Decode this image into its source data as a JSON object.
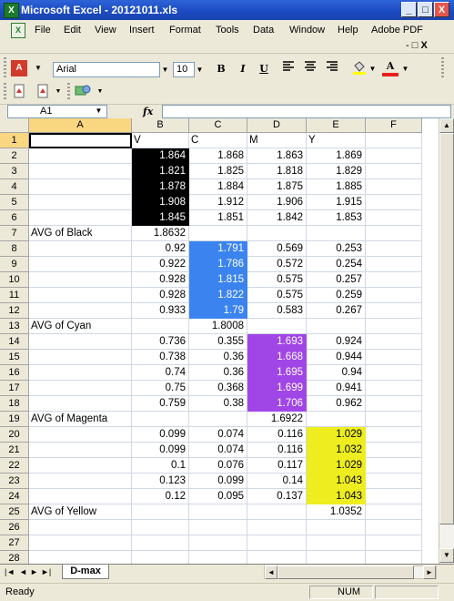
{
  "window": {
    "title": "Microsoft Excel - 20121011.xls",
    "app_icon": "X",
    "controls": [
      "_",
      "□",
      "X"
    ]
  },
  "menu": {
    "items": [
      "File",
      "Edit",
      "View",
      "Insert",
      "Format",
      "Tools",
      "Data",
      "Window",
      "Help",
      "Adobe PDF"
    ],
    "doc_controls": [
      "-",
      "□",
      "X"
    ]
  },
  "toolbar": {
    "font_name": "Arial",
    "font_size": "10",
    "bold": "B",
    "italic": "I",
    "underline": "U",
    "font_color_glyph": "A"
  },
  "formula_bar": {
    "name_box": "A1",
    "fx_label": "fx",
    "formula": ""
  },
  "sheet": {
    "columns": [
      "A",
      "B",
      "C",
      "D",
      "E",
      "F"
    ],
    "colors": {
      "black": "#000000",
      "cyan": "#3b84f0",
      "magenta": "#a046e6",
      "yellow": "#eded20",
      "header_sel": "#f9d680"
    },
    "rows": [
      {
        "r": "1",
        "A": "",
        "B": "V",
        "C": "C",
        "D": "M",
        "E": "Y",
        "F": ""
      },
      {
        "r": "2",
        "A": "",
        "B": "1.864",
        "C": "1.868",
        "D": "1.863",
        "E": "1.869",
        "F": ""
      },
      {
        "r": "3",
        "A": "",
        "B": "1.821",
        "C": "1.825",
        "D": "1.818",
        "E": "1.829",
        "F": ""
      },
      {
        "r": "4",
        "A": "",
        "B": "1.878",
        "C": "1.884",
        "D": "1.875",
        "E": "1.885",
        "F": ""
      },
      {
        "r": "5",
        "A": "",
        "B": "1.908",
        "C": "1.912",
        "D": "1.906",
        "E": "1.915",
        "F": ""
      },
      {
        "r": "6",
        "A": "",
        "B": "1.845",
        "C": "1.851",
        "D": "1.842",
        "E": "1.853",
        "F": ""
      },
      {
        "r": "7",
        "A": "AVG of Black",
        "B": "1.8632",
        "C": "",
        "D": "",
        "E": "",
        "F": ""
      },
      {
        "r": "8",
        "A": "",
        "B": "0.92",
        "C": "1.791",
        "D": "0.569",
        "E": "0.253",
        "F": ""
      },
      {
        "r": "9",
        "A": "",
        "B": "0.922",
        "C": "1.786",
        "D": "0.572",
        "E": "0.254",
        "F": ""
      },
      {
        "r": "10",
        "A": "",
        "B": "0.928",
        "C": "1.815",
        "D": "0.575",
        "E": "0.257",
        "F": ""
      },
      {
        "r": "11",
        "A": "",
        "B": "0.928",
        "C": "1.822",
        "D": "0.575",
        "E": "0.259",
        "F": ""
      },
      {
        "r": "12",
        "A": "",
        "B": "0.933",
        "C": "1.79",
        "D": "0.583",
        "E": "0.267",
        "F": ""
      },
      {
        "r": "13",
        "A": "AVG of Cyan",
        "B": "",
        "C": "1.8008",
        "D": "",
        "E": "",
        "F": ""
      },
      {
        "r": "14",
        "A": "",
        "B": "0.736",
        "C": "0.355",
        "D": "1.693",
        "E": "0.924",
        "F": ""
      },
      {
        "r": "15",
        "A": "",
        "B": "0.738",
        "C": "0.36",
        "D": "1.668",
        "E": "0.944",
        "F": ""
      },
      {
        "r": "16",
        "A": "",
        "B": "0.74",
        "C": "0.36",
        "D": "1.695",
        "E": "0.94",
        "F": ""
      },
      {
        "r": "17",
        "A": "",
        "B": "0.75",
        "C": "0.368",
        "D": "1.699",
        "E": "0.941",
        "F": ""
      },
      {
        "r": "18",
        "A": "",
        "B": "0.759",
        "C": "0.38",
        "D": "1.706",
        "E": "0.962",
        "F": ""
      },
      {
        "r": "19",
        "A": "AVG of Magenta",
        "B": "",
        "C": "",
        "D": "1.6922",
        "E": "",
        "F": ""
      },
      {
        "r": "20",
        "A": "",
        "B": "0.099",
        "C": "0.074",
        "D": "0.116",
        "E": "1.029",
        "F": ""
      },
      {
        "r": "21",
        "A": "",
        "B": "0.099",
        "C": "0.074",
        "D": "0.116",
        "E": "1.032",
        "F": ""
      },
      {
        "r": "22",
        "A": "",
        "B": "0.1",
        "C": "0.076",
        "D": "0.117",
        "E": "1.029",
        "F": ""
      },
      {
        "r": "23",
        "A": "",
        "B": "0.123",
        "C": "0.099",
        "D": "0.14",
        "E": "1.043",
        "F": ""
      },
      {
        "r": "24",
        "A": "",
        "B": "0.12",
        "C": "0.095",
        "D": "0.137",
        "E": "1.043",
        "F": ""
      },
      {
        "r": "25",
        "A": "AVG of Yellow",
        "B": "",
        "C": "",
        "D": "",
        "E": "1.0352",
        "F": ""
      },
      {
        "r": "26",
        "A": "",
        "B": "",
        "C": "",
        "D": "",
        "E": "",
        "F": ""
      },
      {
        "r": "27",
        "A": "",
        "B": "",
        "C": "",
        "D": "",
        "E": "",
        "F": ""
      },
      {
        "r": "28",
        "A": "",
        "B": "",
        "C": "",
        "D": "",
        "E": "",
        "F": ""
      }
    ],
    "highlights": [
      {
        "col": "B",
        "rows": [
          "2",
          "3",
          "4",
          "5",
          "6"
        ],
        "color": "black"
      },
      {
        "col": "C",
        "rows": [
          "8",
          "9",
          "10",
          "11",
          "12"
        ],
        "color": "cyan"
      },
      {
        "col": "D",
        "rows": [
          "14",
          "15",
          "16",
          "17",
          "18"
        ],
        "color": "magenta"
      },
      {
        "col": "E",
        "rows": [
          "20",
          "21",
          "22",
          "23",
          "24"
        ],
        "color": "yellow"
      }
    ],
    "active_cell": "A1"
  },
  "tabs": {
    "sheet_name": "D-max",
    "nav": [
      "|◄",
      "◄",
      "►",
      "►|"
    ]
  },
  "status": {
    "left": "Ready",
    "num": "NUM"
  }
}
